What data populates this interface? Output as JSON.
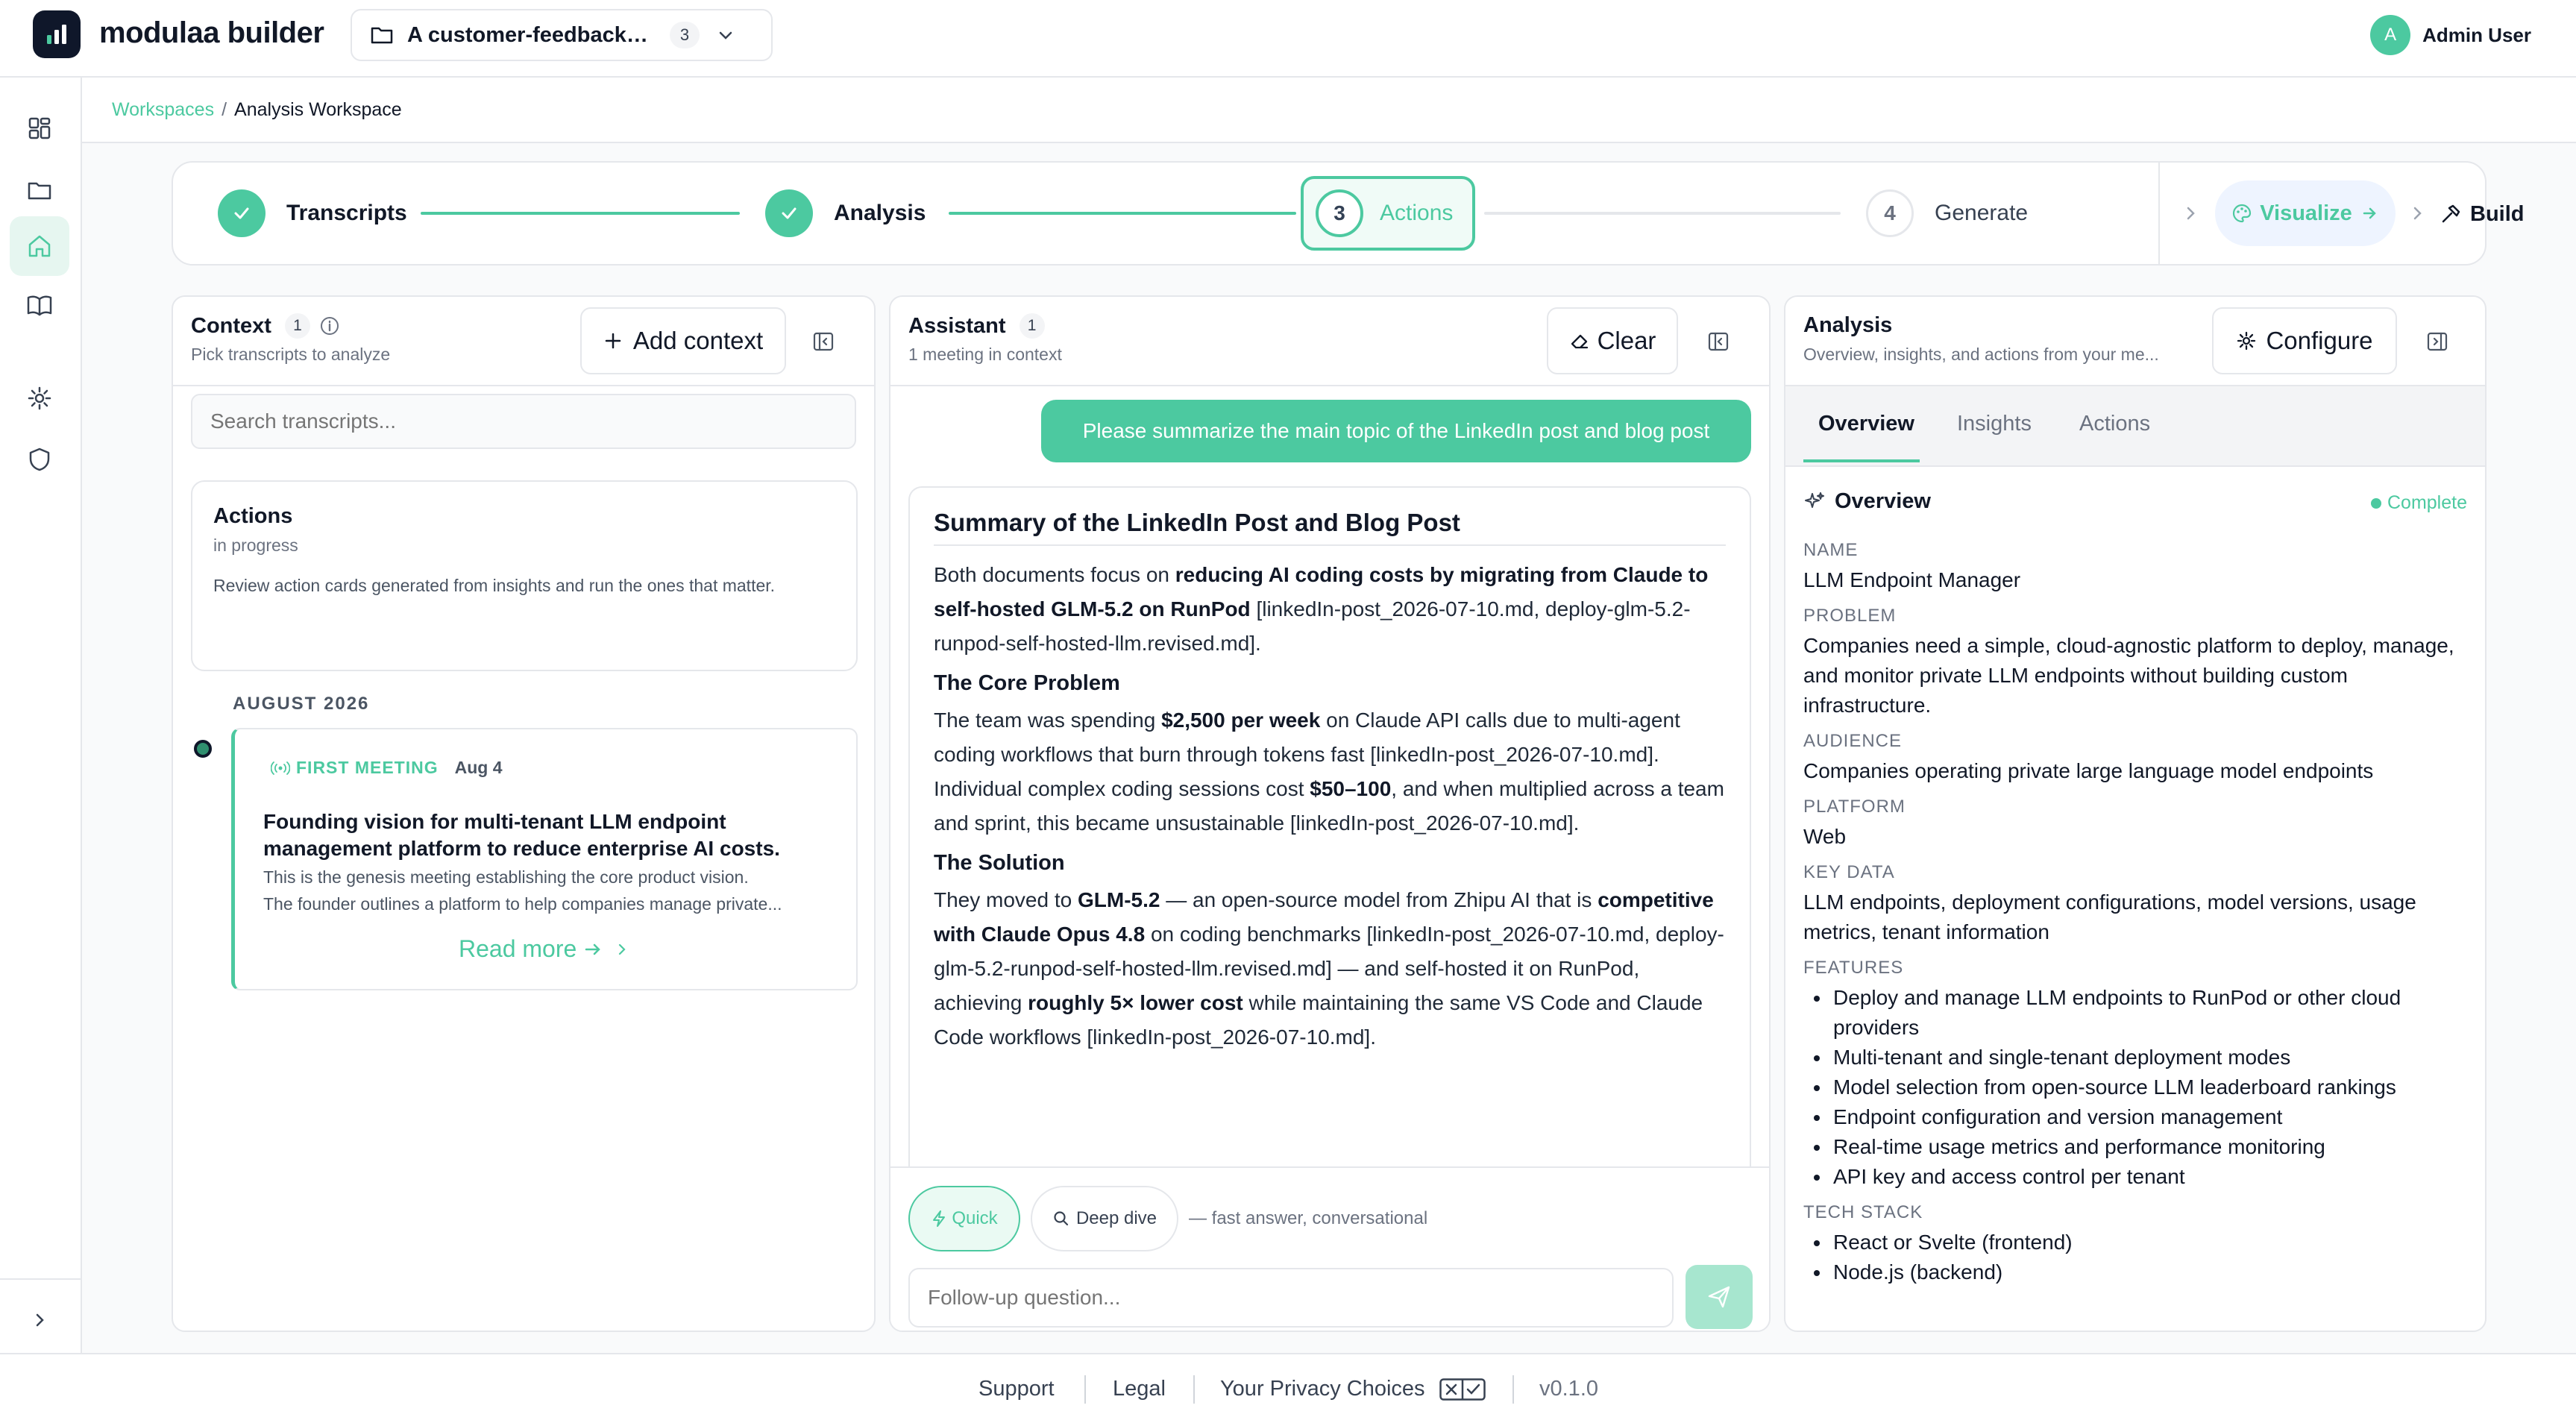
{
  "app": {
    "brand": "modulaa builder"
  },
  "project": {
    "name": "A customer-feedback d...",
    "count": "3"
  },
  "user": {
    "initial": "A",
    "name": "Admin User"
  },
  "sidebar": {
    "items": [
      {
        "name": "dashboard",
        "icon": "dashboard-grid-icon"
      },
      {
        "name": "folders",
        "icon": "folder-icon"
      },
      {
        "name": "home",
        "icon": "home-icon",
        "active": true
      },
      {
        "name": "docs",
        "icon": "book-icon"
      },
      {
        "name": "settings",
        "icon": "gear-icon"
      },
      {
        "name": "security",
        "icon": "shield-icon"
      }
    ]
  },
  "breadcrumb": {
    "root": "Workspaces",
    "separator": "/",
    "current": "Analysis Workspace"
  },
  "stepper": {
    "steps": [
      {
        "label": "Transcripts",
        "state": "done"
      },
      {
        "label": "Analysis",
        "state": "done"
      },
      {
        "number": "3",
        "label": "Actions",
        "state": "current"
      },
      {
        "number": "4",
        "label": "Generate",
        "state": "upcoming"
      }
    ],
    "visualize": "Visualize",
    "build": "Build"
  },
  "context": {
    "title": "Context",
    "count": "1",
    "subtitle": "Pick transcripts to analyze",
    "add_button": "Add context",
    "search_placeholder": "Search transcripts...",
    "status_card": {
      "title": "Actions",
      "state": "in progress",
      "description": "Review action cards generated from insights and run the ones that matter."
    },
    "month": "AUGUST 2026",
    "meeting": {
      "tag": "FIRST MEETING",
      "date": "Aug 4",
      "title": "Founding vision for multi-tenant LLM endpoint management platform to reduce enterprise AI costs.",
      "line1": "This is the genesis meeting establishing the core product vision.",
      "line2": "The founder outlines a platform to help companies manage private...",
      "read_more": "Read more"
    }
  },
  "assistant": {
    "title": "Assistant",
    "count": "1",
    "subtitle": "1 meeting in context",
    "clear_button": "Clear",
    "user_message": "Please summarize the main topic of the LinkedIn post and blog post",
    "response": {
      "heading": "Summary of the LinkedIn Post and Blog Post",
      "p1_a": "Both documents focus on ",
      "p1_b": "reducing AI coding costs by migrating from Claude to self-hosted GLM-5.2 on RunPod",
      "p1_c": " [linkedIn-post_2026-07-10.md, deploy-glm-5.2-runpod-self-hosted-llm.revised.md].",
      "h_problem": "The Core Problem",
      "p2_a": "The team was spending ",
      "p2_b": "$2,500 per week",
      "p2_c": " on Claude API calls due to multi-agent coding workflows that burn through tokens fast [linkedIn-post_2026-07-10.md]. Individual complex coding sessions cost ",
      "p2_d": "$50–100",
      "p2_e": ", and when multiplied across a team and sprint, this became unsustainable [linkedIn-post_2026-07-10.md].",
      "h_solution": "The Solution",
      "p3_a": "They moved to ",
      "p3_b": "GLM-5.2",
      "p3_c": " — an open-source model from Zhipu AI that is ",
      "p3_d": "competitive with Claude Opus 4.8",
      "p3_e": " on coding benchmarks [linkedIn-post_2026-07-10.md, deploy-glm-5.2-runpod-self-hosted-llm.revised.md] — and self-hosted it on RunPod, achieving ",
      "p3_f": "roughly 5× lower cost",
      "p3_g": " while maintaining the same VS Code and Claude Code workflows [linkedIn-post_2026-07-10.md]."
    },
    "mode_quick": "Quick",
    "mode_deep": "Deep dive",
    "mode_hint": "— fast answer, conversational",
    "followup_placeholder": "Follow-up question..."
  },
  "analysis": {
    "title": "Analysis",
    "subtitle": "Overview, insights, and actions from your me...",
    "configure_button": "Configure",
    "tabs": [
      "Overview",
      "Insights",
      "Actions"
    ],
    "section": "Overview",
    "status": "Complete",
    "name_label": "NAME",
    "name": "LLM Endpoint Manager",
    "problem_label": "PROBLEM",
    "problem": "Companies need a simple, cloud-agnostic platform to deploy, manage, and monitor private LLM endpoints without building custom infrastructure.",
    "audience_label": "AUDIENCE",
    "audience": "Companies operating private large language model endpoints",
    "platform_label": "PLATFORM",
    "platform": "Web",
    "keydata_label": "KEY DATA",
    "keydata": "LLM endpoints, deployment configurations, model versions, usage metrics, tenant information",
    "features_label": "FEATURES",
    "features": [
      "Deploy and manage LLM endpoints to RunPod or other cloud providers",
      "Multi-tenant and single-tenant deployment modes",
      "Model selection from open-source LLM leaderboard rankings",
      "Endpoint configuration and version management",
      "Real-time usage metrics and performance monitoring",
      "API key and access control per tenant"
    ],
    "techstack_label": "TECH STACK",
    "techstack": [
      "React or Svelte (frontend)",
      "Node.js (backend)"
    ]
  },
  "footer": {
    "support": "Support",
    "legal": "Legal",
    "privacy": "Your Privacy Choices",
    "version": "v0.1.0"
  },
  "colors": {
    "accent": "#4cc9a0",
    "dark": "#0f172a",
    "border": "#e5e7eb"
  }
}
